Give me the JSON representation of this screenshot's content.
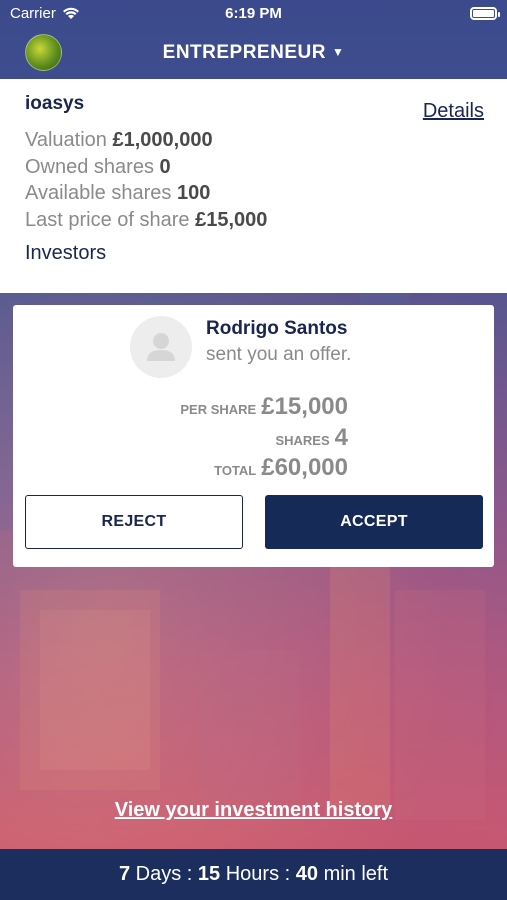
{
  "status": {
    "carrier": "Carrier",
    "time": "6:19 PM"
  },
  "nav": {
    "title": "ENTREPRENEUR",
    "caret": "▼"
  },
  "company": {
    "name": "ioasys",
    "details_label": "Details",
    "valuation_label": "Valuation",
    "valuation_value": "£1,000,000",
    "owned_label": "Owned shares",
    "owned_value": "0",
    "available_label": "Available shares",
    "available_value": "100",
    "last_price_label": "Last price of share",
    "last_price_value": "£15,000",
    "investors_label": "Investors"
  },
  "offer": {
    "sender_name": "Rodrigo Santos",
    "message": "sent you an offer.",
    "per_share_label": "PER SHARE",
    "per_share_value": "£15,000",
    "shares_label": "SHARES",
    "shares_value": "4",
    "total_label": "TOTAL",
    "total_value": "£60,000",
    "reject_label": "REJECT",
    "accept_label": "ACCEPT"
  },
  "history_link": "View your investment history",
  "footer": {
    "days": "7",
    "days_unit": "Days",
    "hours": "15",
    "hours_unit": "Hours",
    "minutes": "40",
    "minutes_unit": "min left"
  },
  "colors": {
    "primary": "#1a2550",
    "accent_button": "#162a57",
    "footer": "#1b2e5d"
  },
  "icons": {
    "wifi": "wifi-icon",
    "battery": "battery-icon",
    "user_placeholder": "user-placeholder-icon"
  }
}
